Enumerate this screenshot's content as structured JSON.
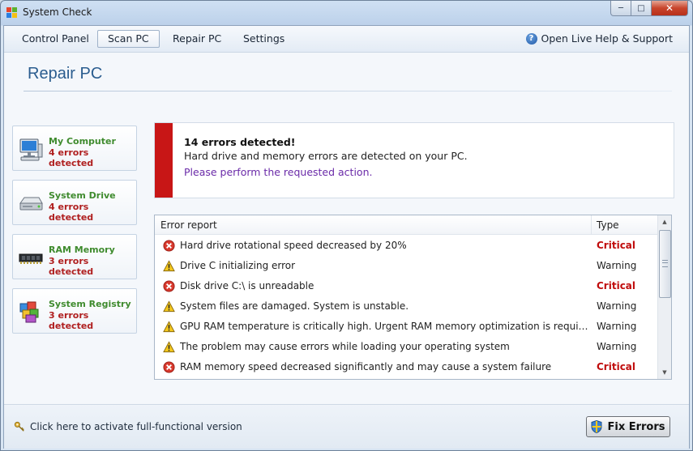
{
  "window": {
    "title": "System Check"
  },
  "menu": {
    "tabs": [
      {
        "label": "Control Panel"
      },
      {
        "label": "Scan PC"
      },
      {
        "label": "Repair PC"
      },
      {
        "label": "Settings"
      }
    ],
    "help_label": "Open Live Help & Support"
  },
  "page": {
    "title": "Repair PC"
  },
  "sidebar": {
    "items": [
      {
        "name": "My Computer",
        "count": "4 errors detected",
        "icon": "computer-icon"
      },
      {
        "name": "System Drive",
        "count": "4 errors detected",
        "icon": "hard-drive-icon"
      },
      {
        "name": "RAM Memory",
        "count": "3 errors detected",
        "icon": "ram-chip-icon"
      },
      {
        "name": "System Registry",
        "count": "3 errors detected",
        "icon": "registry-icon"
      }
    ]
  },
  "alert": {
    "heading": "14 errors detected!",
    "description": "Hard drive and memory errors are detected on your PC.",
    "action": "Please perform the requested action.",
    "accent_color": "#c81616"
  },
  "report": {
    "columns": [
      "Error report",
      "Type"
    ],
    "rows": [
      {
        "text": "Hard drive rotational speed decreased by 20%",
        "type": "Critical",
        "icon": "error-icon"
      },
      {
        "text": "Drive C initializing error",
        "type": "Warning",
        "icon": "warning-icon"
      },
      {
        "text": "Disk drive C:\\ is unreadable",
        "type": "Critical",
        "icon": "error-icon"
      },
      {
        "text": "System files are damaged. System is unstable.",
        "type": "Warning",
        "icon": "warning-icon"
      },
      {
        "text": "GPU RAM temperature is critically high. Urgent RAM memory optimization is required to prevent system crash.",
        "type": "Warning",
        "icon": "warning-icon"
      },
      {
        "text": "The problem may cause errors while loading your operating system",
        "type": "Warning",
        "icon": "warning-icon"
      },
      {
        "text": "RAM memory speed decreased significantly and may cause a system failure",
        "type": "Critical",
        "icon": "error-icon"
      }
    ]
  },
  "footer": {
    "activate_label": "Click here to activate full-functional version",
    "fix_label": "Fix Errors"
  }
}
